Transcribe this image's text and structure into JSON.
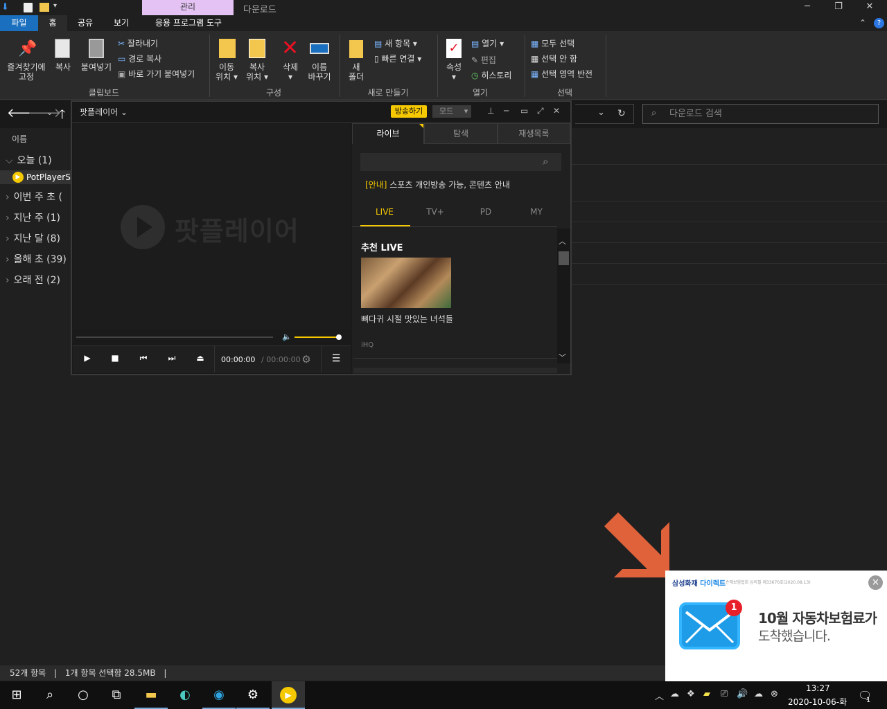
{
  "titlebar": {
    "manage_tab": "관리",
    "title": "다운로드",
    "minimize": "─",
    "maximize": "❐",
    "close": "✕"
  },
  "ribbon_tabs": {
    "file": "파일",
    "home": "홈",
    "share": "공유",
    "view": "보기",
    "app_tools": "응용 프로그램 도구"
  },
  "ribbon": {
    "pin_line1": "즐겨찾기에",
    "pin_line2": "고정",
    "copy": "복사",
    "paste": "붙여넣기",
    "cut": "잘라내기",
    "copy_path": "경로 복사",
    "paste_shortcut": "바로 가기 붙여넣기",
    "clipboard": "클립보드",
    "move_l1": "이동",
    "move_l2": "위치",
    "copy_to_l1": "복사",
    "copy_to_l2": "위치",
    "delete": "삭제",
    "rename_l1": "이름",
    "rename_l2": "바꾸기",
    "organize": "구성",
    "new_folder_l1": "새",
    "new_folder_l2": "폴더",
    "new_item": "새 항목",
    "easy_access": "빠른 연결",
    "new_group": "새로 만들기",
    "properties": "속성",
    "open": "열기",
    "edit": "편집",
    "history": "히스토리",
    "open_group": "열기",
    "select_all": "모두 선택",
    "select_none": "선택 안 함",
    "invert": "선택 영역 반전",
    "select_group": "선택"
  },
  "nav": {
    "search_placeholder": "다운로드 검색"
  },
  "filelist": {
    "col_name": "이름",
    "groups": [
      "오늘 (1)",
      "이번 주 초 (",
      "지난 주 (1)",
      "지난 달 (8)",
      "올해 초 (39)",
      "오래 전 (2)"
    ],
    "file": "PotPlayerSe"
  },
  "potplayer": {
    "name": "팟플레이어",
    "broadcast": "방송하기",
    "mode": "모드",
    "logo": "팟플레이어",
    "time_current": "00:00:00",
    "time_sep": "/",
    "time_total": "00:00:00",
    "tabs": [
      "라이브",
      "탐색",
      "재생목록"
    ],
    "notice_tag": "[안내]",
    "notice": "스포츠 개인방송 가능, 콘텐츠 안내",
    "live_tabs": [
      "LIVE",
      "TV+",
      "PD",
      "MY"
    ],
    "section": "추천 LIVE",
    "item_title": "뼈다귀 시절 맛있는 녀석들",
    "item_channel": "iHQ"
  },
  "status": {
    "count": "52개 항목",
    "selected": "1개 항목 선택함 28.5MB"
  },
  "ad": {
    "brand": "삼성화재",
    "brand2": "다이렉트",
    "small": "손해보험협회 심의필 제33670호(2020.08.13)",
    "badge": "1",
    "line1": "10월 자동차보험료가",
    "line2": "도착했습니다."
  },
  "taskbar": {
    "time": "13:27",
    "date": "2020-10-06-화",
    "notif_count": "1"
  },
  "colors": {
    "accent": "#f5c800",
    "file_tab": "#1a6fbf",
    "manage": "#e4c3f4",
    "ad_arrow": "#e0623a"
  }
}
